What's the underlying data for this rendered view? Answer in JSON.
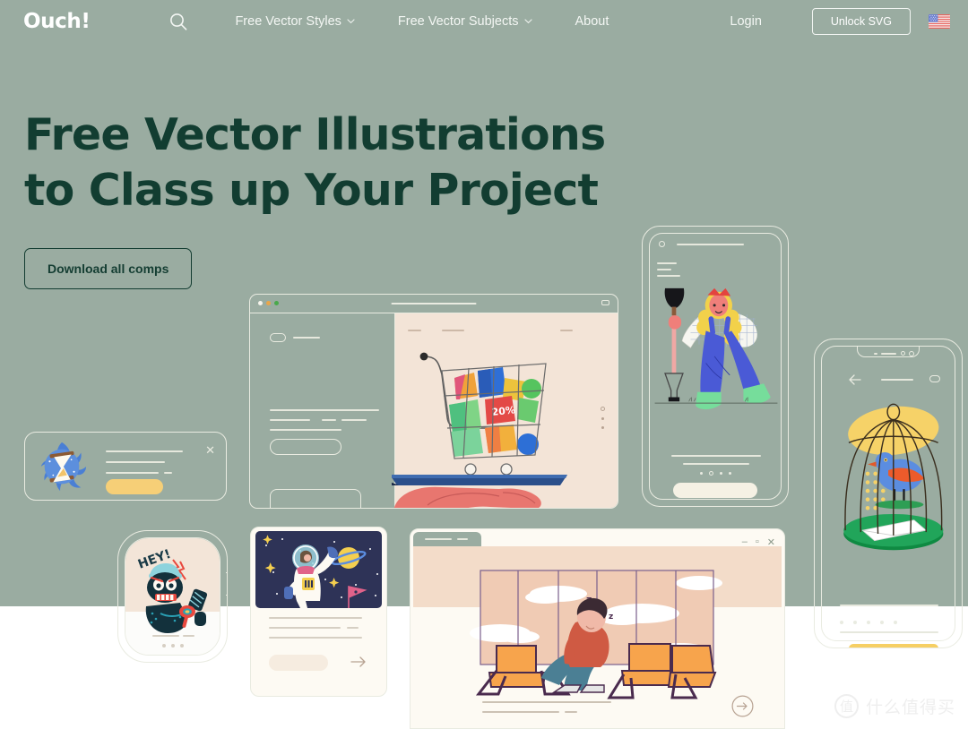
{
  "meta": {
    "site_name": "Ouch!",
    "background_color": "#9aaca1",
    "accent_dark": "#143d32",
    "text_light": "#f4f7f4"
  },
  "nav": {
    "logo": "Ouch!",
    "search_icon": "search-icon",
    "links": [
      {
        "label": "Free Vector Styles",
        "has_caret": true,
        "caret": "⌄"
      },
      {
        "label": "Free Vector Subjects",
        "has_caret": true,
        "caret": "⌄"
      },
      {
        "label": "About",
        "has_caret": false,
        "caret": ""
      }
    ],
    "login_label": "Login",
    "unlock_label": "Unlock SVG",
    "flag_icon": "us-flag-icon"
  },
  "hero": {
    "headline_line1": "Free Vector Illustrations",
    "headline_line2": "to Class up Your Project",
    "cta_label": "Download all comps"
  },
  "illustrations": {
    "browser_window": {
      "name": "shopping-cart-browser-mockup",
      "traffic_lights": [
        "#f6f4ec",
        "#e8a64b",
        "#49a94c"
      ],
      "scene": "hand holding tray with shopping cart full of colorful gift boxes",
      "content_bg": "#f3e4d7"
    },
    "phone_gardener": {
      "name": "gardener-phone-mockup",
      "scene": "woman with shovel wearing blue overalls and green boots",
      "dots_count": 4
    },
    "phone_birdcage": {
      "name": "birdcage-phone-mockup",
      "scene": "blue and orange bird inside a cage with a letter",
      "back_icon": "arrow-left-icon",
      "dots_count": 5
    },
    "toast_hourglass": {
      "name": "hourglass-notification-toast",
      "scene": "hourglass in blue swirl badge",
      "close_icon": "close-icon"
    },
    "smart_watch": {
      "name": "smartwatch-mockup",
      "scene": "angry dark monster character",
      "speech_text": "HEY!"
    },
    "astronaut_card": {
      "name": "astronaut-card-mockup",
      "scene": "astronaut floating in space with planet, flag and stars",
      "arrow_icon": "arrow-right-icon"
    },
    "airport_window": {
      "name": "airport-waiting-window-mockup",
      "scene": "man sleeping on orange airport seats",
      "sleep_text": "z",
      "window_controls": [
        "–",
        "▫",
        "✕"
      ],
      "arrow_icon": "arrow-right-circle-icon"
    }
  },
  "watermark": {
    "logo_char": "值",
    "text": "什么值得买"
  }
}
